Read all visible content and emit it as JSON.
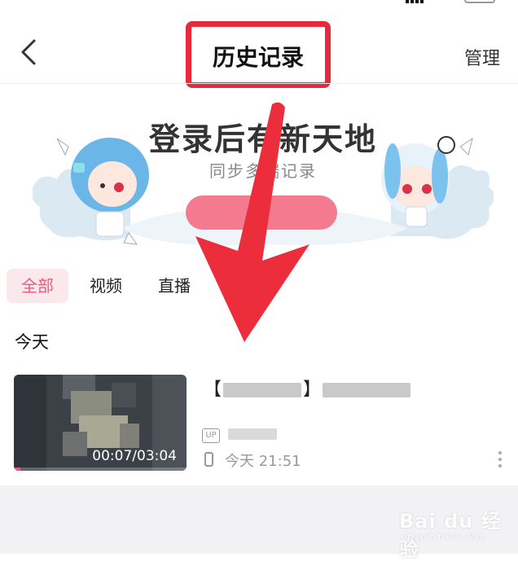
{
  "header": {
    "title": "历史记录",
    "manage_label": "管理"
  },
  "banner": {
    "title": "登录后有新天地",
    "subtitle": "同步多端记录"
  },
  "tabs": [
    {
      "label": "全部",
      "active": true
    },
    {
      "label": "视频",
      "active": false
    },
    {
      "label": "直播",
      "active": false
    }
  ],
  "section": {
    "today_label": "今天"
  },
  "history": [
    {
      "title_prefix": "【",
      "title_mid": "】",
      "duration": "00:07/03:04",
      "progress": 0.04,
      "up_badge": "UP",
      "time": "今天 21:51"
    }
  ],
  "colors": {
    "accent_pink": "#ef5a7b",
    "highlight_red": "#e8283f",
    "arrow_red": "#ec2d3c"
  },
  "icons": {
    "back": "chevron-left-icon",
    "device": "phone-icon",
    "more": "more-vertical-icon"
  },
  "watermark": {
    "text": "Bai du 经验",
    "url": "jingyan.baidu.com"
  }
}
